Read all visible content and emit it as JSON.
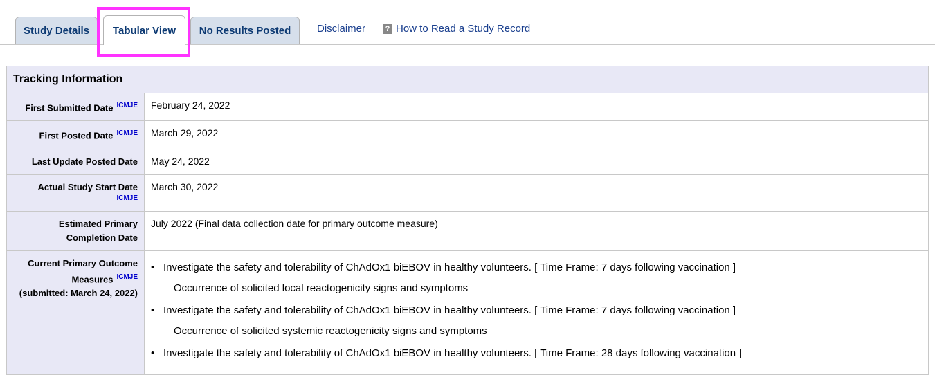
{
  "tabs": [
    "Study Details",
    "Tabular View",
    "No Results Posted"
  ],
  "links": {
    "disclaimer": "Disclaimer",
    "how_to_read": "How to Read a Study Record",
    "help_icon_glyph": "?"
  },
  "icmje_label": "ICMJE",
  "section_title": "Tracking Information",
  "rows": [
    {
      "label": "First Submitted Date",
      "value": "February 24, 2022"
    },
    {
      "label": "First Posted Date",
      "value": "March 29, 2022"
    },
    {
      "label": "Last Update Posted Date",
      "value": "May 24, 2022"
    },
    {
      "label": "Actual Study Start Date",
      "value": "March 30, 2022"
    },
    {
      "label": "Estimated Primary Completion Date",
      "value": "July 2022   (Final data collection date for primary outcome measure)"
    }
  ],
  "primary_outcome": {
    "label_line1": "Current Primary Outcome",
    "label_line2": "Measures",
    "label_line3": "(submitted: March 24, 2022)",
    "items": [
      {
        "text": "Investigate the safety and tolerability of ChAdOx1 biEBOV in healthy volunteers. [ Time Frame: 7 days following vaccination ]",
        "desc": "Occurrence of solicited local reactogenicity signs and symptoms"
      },
      {
        "text": "Investigate the safety and tolerability of ChAdOx1 biEBOV in healthy volunteers. [ Time Frame: 7 days following vaccination ]",
        "desc": "Occurrence of solicited systemic reactogenicity signs and symptoms"
      },
      {
        "text": "Investigate the safety and tolerability of ChAdOx1 biEBOV in healthy volunteers. [ Time Frame: 28 days following vaccination ]",
        "desc": ""
      }
    ]
  },
  "colors": {
    "highlight": "#ff33ff",
    "tab_bg": "#d6dfeb",
    "label_bg": "#e8e8f6",
    "link": "#1a3f8e",
    "icmje": "#0000cc"
  }
}
